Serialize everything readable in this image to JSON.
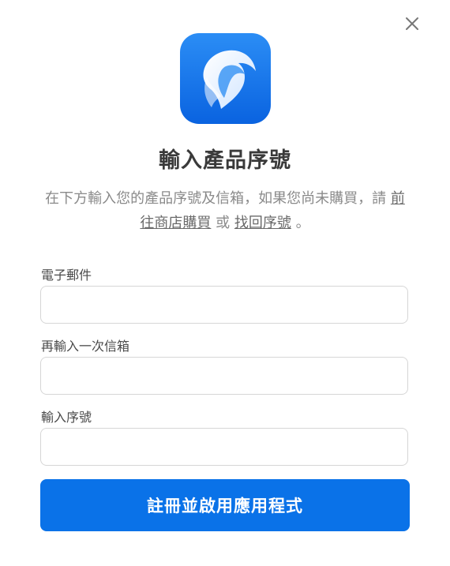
{
  "dialog": {
    "title": "輸入產品序號",
    "description": {
      "before": "在下方輸入您的產品序號及信箱，如果您尚未購買，請",
      "link_store": "前往商店購買",
      "middle": "或",
      "link_recover": "找回序號",
      "after": "。"
    },
    "fields": [
      {
        "label": "電子郵件",
        "value": "",
        "placeholder": ""
      },
      {
        "label": "再輸入一次信箱",
        "value": "",
        "placeholder": ""
      },
      {
        "label": "輸入序號",
        "value": "",
        "placeholder": ""
      }
    ],
    "submit_label": "註冊並啟用應用程式"
  },
  "icons": {
    "close": "close-icon",
    "app_logo": "bird-logo"
  },
  "colors": {
    "accent": "#0a72e8",
    "logo_gradient_top": "#2b8df5",
    "logo_gradient_bottom": "#0a63e0",
    "title_text": "#3a3a3a",
    "body_text": "#8a8a8a",
    "input_border": "#d6d6d6"
  }
}
